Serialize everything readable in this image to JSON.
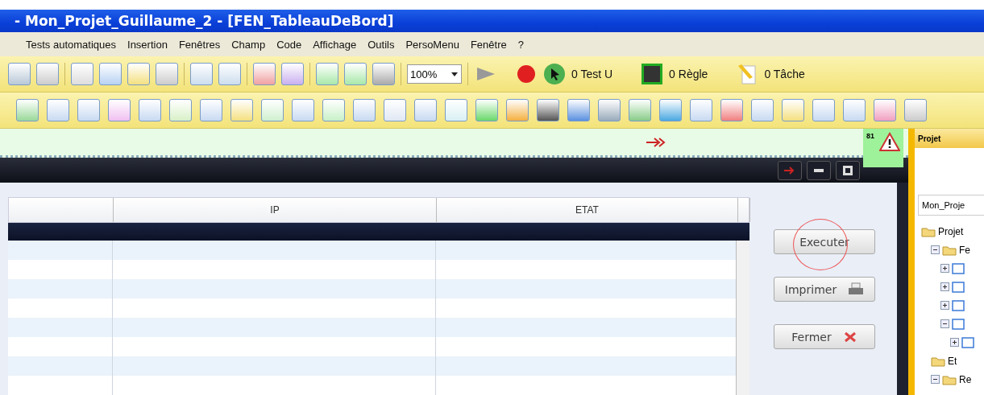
{
  "window": {
    "title": "- Mon_Projet_Guillaume_2 - [FEN_TableauDeBord]"
  },
  "menu": [
    "Tests automatiques",
    "Insertion",
    "Fenêtres",
    "Champ",
    "Code",
    "Affichage",
    "Outils",
    "PersoMenu",
    "Fenêtre",
    "?"
  ],
  "toolbar": {
    "zoom": "100%",
    "counters": [
      {
        "kind": "test",
        "label": "0 Test U"
      },
      {
        "kind": "rule",
        "label": "0 Règle"
      },
      {
        "kind": "task",
        "label": "0 Tâche"
      }
    ]
  },
  "editor": {
    "warning_count": "81"
  },
  "table": {
    "columns": [
      {
        "label": "IP"
      },
      {
        "label": "ETAT"
      }
    ]
  },
  "buttons": [
    {
      "kind": "plain",
      "label": "Executer",
      "highlighted": true
    },
    {
      "kind": "print",
      "label": "Imprimer",
      "highlighted": false
    },
    {
      "kind": "close",
      "label": "Fermer",
      "highlighted": false
    }
  ],
  "project_panel": {
    "title": "Projet",
    "combo": "Mon_Proje",
    "tree": [
      {
        "label": "Projet",
        "children": [
          {
            "label": "Fe",
            "expanded": true,
            "children": [
              {
                "expanded": false
              },
              {
                "expanded": false
              },
              {
                "expanded": false
              },
              {
                "expanded": true,
                "children": [
                  {
                    "expanded": false
                  }
                ]
              }
            ]
          },
          {
            "label": "Et"
          },
          {
            "label": "Re",
            "expanded": true
          }
        ]
      }
    ]
  }
}
